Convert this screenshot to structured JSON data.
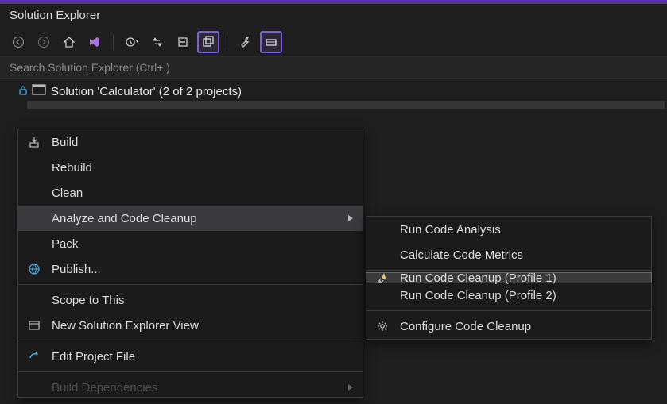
{
  "panel": {
    "title": "Solution Explorer"
  },
  "search": {
    "placeholder": "Search Solution Explorer (Ctrl+;)"
  },
  "solution": {
    "label": "Solution 'Calculator' (2 of 2 projects)"
  },
  "contextMenu": {
    "items": [
      {
        "label": "Build"
      },
      {
        "label": "Rebuild"
      },
      {
        "label": "Clean"
      },
      {
        "label": "Analyze and Code Cleanup"
      },
      {
        "label": "Pack"
      },
      {
        "label": "Publish..."
      },
      {
        "label": "Scope to This"
      },
      {
        "label": "New Solution Explorer View"
      },
      {
        "label": "Edit Project File"
      },
      {
        "label": "Build Dependencies"
      }
    ]
  },
  "submenu": {
    "items": [
      {
        "label": "Run Code Analysis"
      },
      {
        "label": "Calculate Code Metrics"
      },
      {
        "label": "Run Code Cleanup (Profile 1)"
      },
      {
        "label": "Run Code Cleanup (Profile 2)"
      },
      {
        "label": "Configure Code Cleanup"
      }
    ]
  }
}
